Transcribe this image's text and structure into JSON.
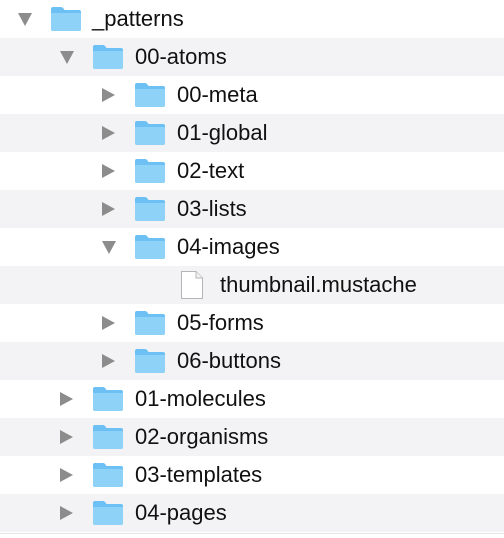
{
  "tree": [
    {
      "label": "_patterns",
      "depth": 0,
      "kind": "folder",
      "expanded": true
    },
    {
      "label": "00-atoms",
      "depth": 1,
      "kind": "folder",
      "expanded": true
    },
    {
      "label": "00-meta",
      "depth": 2,
      "kind": "folder",
      "expanded": false
    },
    {
      "label": "01-global",
      "depth": 2,
      "kind": "folder",
      "expanded": false
    },
    {
      "label": "02-text",
      "depth": 2,
      "kind": "folder",
      "expanded": false
    },
    {
      "label": "03-lists",
      "depth": 2,
      "kind": "folder",
      "expanded": false
    },
    {
      "label": "04-images",
      "depth": 2,
      "kind": "folder",
      "expanded": true
    },
    {
      "label": "thumbnail.mustache",
      "depth": 3,
      "kind": "file"
    },
    {
      "label": "05-forms",
      "depth": 2,
      "kind": "folder",
      "expanded": false
    },
    {
      "label": "06-buttons",
      "depth": 2,
      "kind": "folder",
      "expanded": false
    },
    {
      "label": "01-molecules",
      "depth": 1,
      "kind": "folder",
      "expanded": false
    },
    {
      "label": "02-organisms",
      "depth": 1,
      "kind": "folder",
      "expanded": false
    },
    {
      "label": "03-templates",
      "depth": 1,
      "kind": "folder",
      "expanded": false
    },
    {
      "label": "04-pages",
      "depth": 1,
      "kind": "folder",
      "expanded": false
    }
  ],
  "colors": {
    "folder_body": "#8ed2f8",
    "folder_tab": "#6cc0f3",
    "disclosure": "#8c8c8c",
    "zebra": "#f3f3f5"
  }
}
